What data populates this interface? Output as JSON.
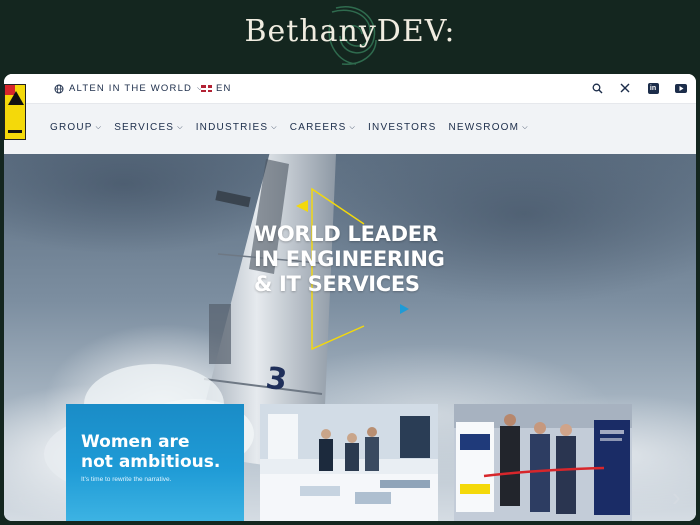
{
  "banner": {
    "title": "BethanyDEV:"
  },
  "topbar": {
    "world_label": "ALTEN IN THE WORLD",
    "lang_label": "EN",
    "icons": [
      "search-icon",
      "x-icon",
      "linkedin-icon",
      "youtube-icon"
    ]
  },
  "nav": {
    "items": [
      {
        "label": "GROUP",
        "has_menu": true
      },
      {
        "label": "SERVICES",
        "has_menu": true
      },
      {
        "label": "INDUSTRIES",
        "has_menu": true
      },
      {
        "label": "CAREERS",
        "has_menu": true
      },
      {
        "label": "INVESTORS",
        "has_menu": false
      },
      {
        "label": "NEWSROOM",
        "has_menu": true
      }
    ]
  },
  "hero": {
    "line1": "WORLD LEADER",
    "line2": "IN ENGINEERING",
    "line3": "& IT SERVICES",
    "rocket_number": "3",
    "accent": "#f4d90a"
  },
  "cards": [
    {
      "headline1": "Women are",
      "headline2": "not ambitious.",
      "sub": "It's time to rewrite the narrative."
    },
    {
      "kind": "business-meeting-photo"
    },
    {
      "kind": "ribbon-cutting-photo"
    }
  ],
  "colors": {
    "navy": "#1c2d4a",
    "brand_yellow": "#f4d90a",
    "card_blue": "#1f9bd6"
  }
}
